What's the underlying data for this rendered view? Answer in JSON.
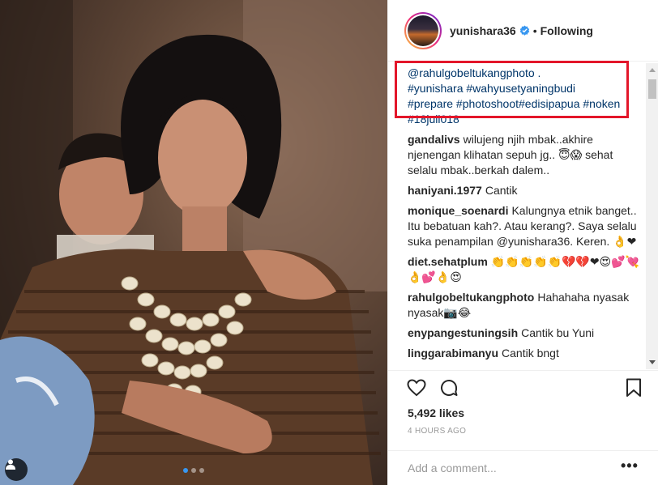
{
  "post": {
    "username": "yunishara36",
    "separator": "•",
    "follow_status": "Following",
    "verified": true
  },
  "caption": {
    "partial_top": "@rahulgobeltukangphoto .",
    "hashtags_line1": "#yunishara #wahyusetyaningbudi",
    "hashtags_line2": "#prepare #photoshoot#edisipapua #noken",
    "hashtags_line3": "#18juli018"
  },
  "comments": [
    {
      "user": "gandalivs",
      "text": "wilujeng njih mbak..akhire njenengan klihatan sepuh jg.. 😇😱 sehat selalu mbak..berkah dalem.."
    },
    {
      "user": "haniyani.1977",
      "text": "Cantik"
    },
    {
      "user": "monique_soenardi",
      "text": "Kalungnya etnik banget.. Itu bebatuan kah?. Atau kerang?. Saya selalu suka penampilan @yunishara36. Keren. 👌❤"
    },
    {
      "user": "diet.sehatplum",
      "text": "👏👏👏👏👏💔💔❤😍💕💘👌💕👌😍"
    },
    {
      "user": "rahulgobeltukangphoto",
      "text": "Hahahaha nyasak nyasak📷😂"
    },
    {
      "user": "enypangestuningsih",
      "text": "Cantik bu Yuni"
    },
    {
      "user": "linggarabimanyu",
      "text": "Cantik bngt"
    }
  ],
  "stats": {
    "likes": "5,492 likes",
    "time": "4 HOURS AGO"
  },
  "add_comment": {
    "placeholder": "Add a comment...",
    "more": "•••"
  },
  "icons": {
    "like": "heart-icon",
    "comment": "comment-icon",
    "save": "bookmark-icon",
    "tag": "person-tag-icon",
    "verified": "verified-badge-icon"
  },
  "colors": {
    "highlight_box": "#e3162a",
    "link": "#003569",
    "verified": "#3897f0",
    "carousel_active": "#3897f0"
  },
  "carousel": {
    "count": 3,
    "active_index": 0
  }
}
